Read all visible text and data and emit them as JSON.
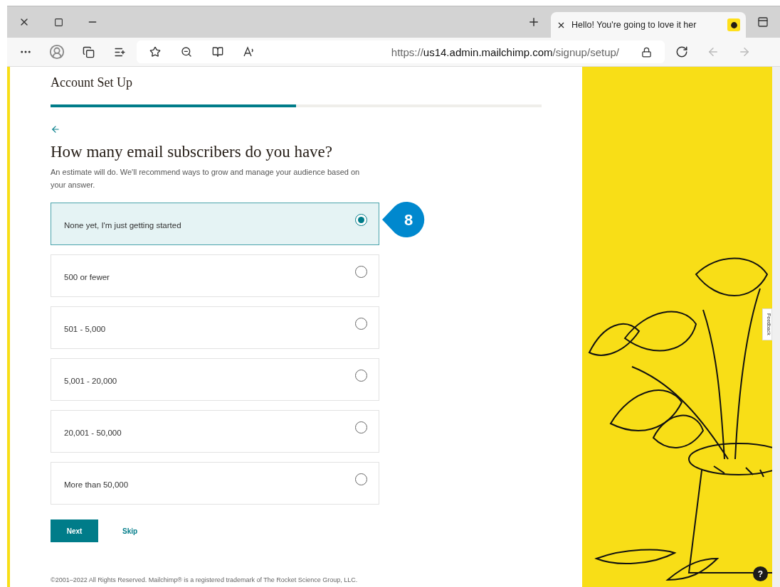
{
  "browser": {
    "tab_title": "Hello! You're going to love it her",
    "url_prefix": "https://",
    "url_host": "us14.admin.mailchimp.com",
    "url_path": "/signup/setup/"
  },
  "page": {
    "section_title": "Account Set Up",
    "progress": {
      "level": 0.5
    },
    "question": "How many email subscribers do you have?",
    "hint": "An estimate will do. We'll recommend ways to grow and manage your audience based on your answer.",
    "options": [
      {
        "label": "None yet, I'm just getting started",
        "selected": true
      },
      {
        "label": "500 or fewer",
        "selected": false
      },
      {
        "label": "501 - 5,000",
        "selected": false
      },
      {
        "label": "5,001 - 20,000",
        "selected": false
      },
      {
        "label": "20,001 - 50,000",
        "selected": false
      },
      {
        "label": "More than 50,000",
        "selected": false
      }
    ],
    "buttons": {
      "primary": "Next",
      "secondary": "Skip"
    },
    "footer": "©2001–2022 All Rights Reserved. Mailchimp® is a registered trademark of The Rocket Science Group, LLC."
  },
  "callout": {
    "number": "8"
  },
  "side_panel": {
    "feedback": "Feedback",
    "help": "?"
  }
}
